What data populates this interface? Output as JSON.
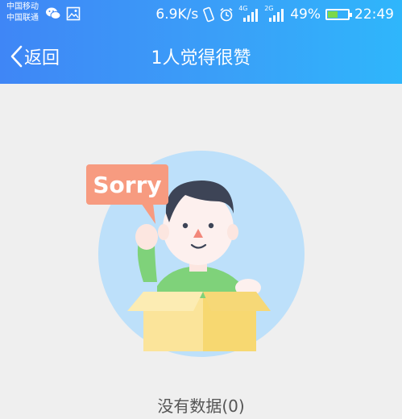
{
  "status_bar": {
    "carrier1": "中国移动",
    "carrier2": "中国联通",
    "net_speed": "6.9K/s",
    "battery": "49%",
    "time": "22:49",
    "signal1_label": "4G",
    "signal2_label": "2G"
  },
  "nav": {
    "back_label": "返回",
    "title": "1人觉得很赞"
  },
  "illustration": {
    "bubble_text": "Sorry"
  },
  "empty_state": {
    "text": "没有数据(0)"
  },
  "colors": {
    "header_left": "#3f86f6",
    "header_right": "#2fb6fb",
    "background": "#efefef",
    "bubble": "#f79b80",
    "circle": "#bde0fa"
  }
}
